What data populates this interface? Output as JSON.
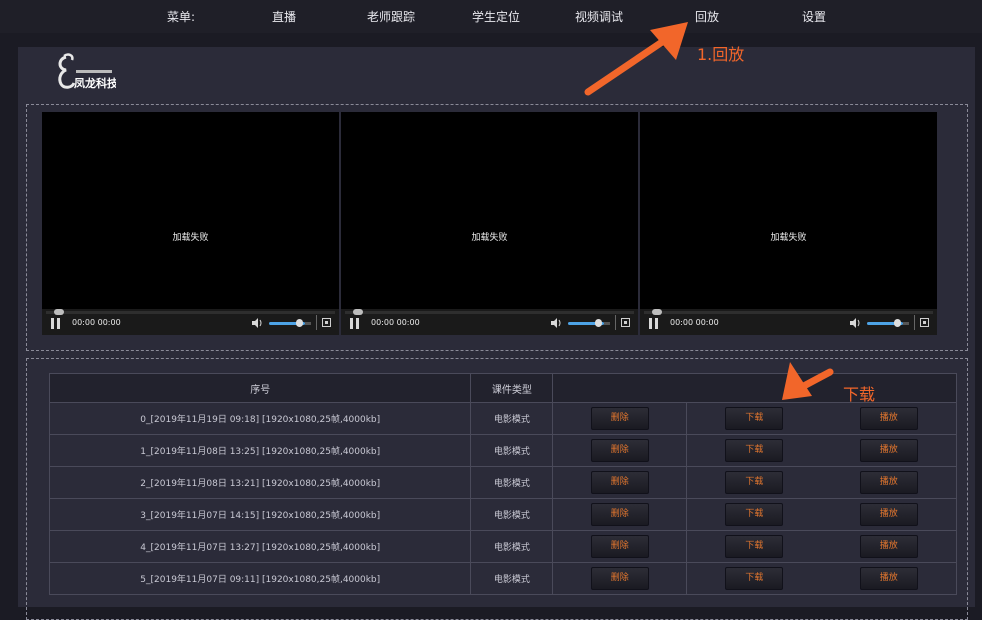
{
  "nav": {
    "menu_label": "菜单:",
    "items": [
      "直播",
      "老师跟踪",
      "学生定位",
      "视频调试",
      "回放",
      "设置"
    ]
  },
  "logo": {
    "text": "凤龙科技"
  },
  "players": [
    {
      "message": "加载失败",
      "time": "00:00 00:00"
    },
    {
      "message": "加载失败",
      "time": "00:00  00:00"
    },
    {
      "message": "加载失败",
      "time": "00:00  00:00"
    }
  ],
  "table": {
    "headers": [
      "序号",
      "课件类型",
      ""
    ],
    "rows": [
      {
        "name": "0_[2019年11月19日 09:18] [1920x1080,25帧,4000kb]",
        "type": "电影模式",
        "delete": "删除",
        "download": "下载",
        "play": "播放"
      },
      {
        "name": "1_[2019年11月08日 13:25] [1920x1080,25帧,4000kb]",
        "type": "电影模式",
        "delete": "删除",
        "download": "下载",
        "play": "播放"
      },
      {
        "name": "2_[2019年11月08日 13:21] [1920x1080,25帧,4000kb]",
        "type": "电影模式",
        "delete": "删除",
        "download": "下载",
        "play": "播放"
      },
      {
        "name": "3_[2019年11月07日 14:15] [1920x1080,25帧,4000kb]",
        "type": "电影模式",
        "delete": "删除",
        "download": "下载",
        "play": "播放"
      },
      {
        "name": "4_[2019年11月07日 13:27] [1920x1080,25帧,4000kb]",
        "type": "电影模式",
        "delete": "删除",
        "download": "下载",
        "play": "播放"
      },
      {
        "name": "5_[2019年11月07日 09:11] [1920x1080,25帧,4000kb]",
        "type": "电影模式",
        "delete": "删除",
        "download": "下载",
        "play": "播放"
      }
    ]
  },
  "annotations": {
    "step1": "1.回放",
    "download": "下载"
  },
  "colors": {
    "accent": "#f2662a",
    "button_text": "#e2762e"
  }
}
